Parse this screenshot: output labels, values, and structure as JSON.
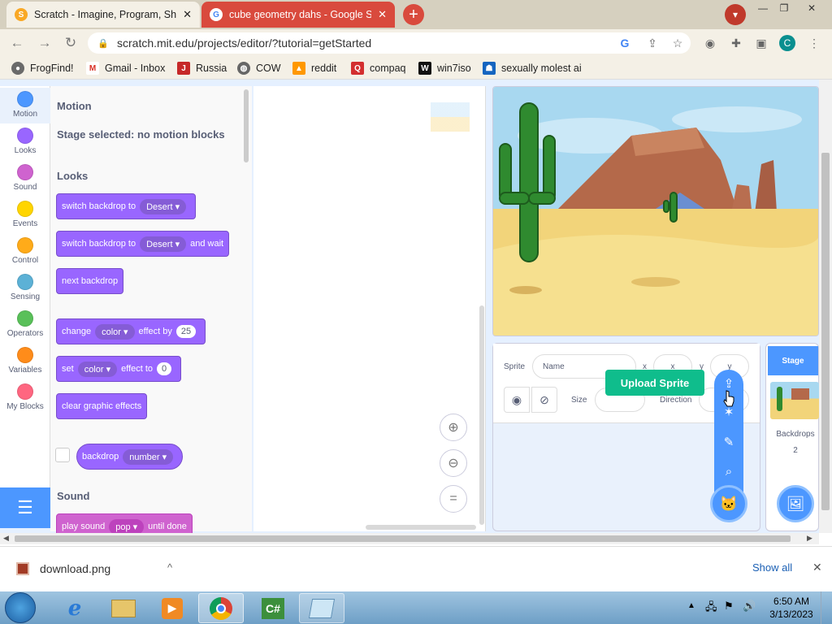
{
  "browser": {
    "tabs": [
      {
        "title": "Scratch - Imagine, Program, Share",
        "active": true
      },
      {
        "title": "cube geometry dahs - Google Search",
        "active": false
      }
    ],
    "url": "scratch.mit.edu/projects/editor/?tutorial=getStarted",
    "profile_initial": "C",
    "bookmarks": [
      {
        "label": "FrogFind!"
      },
      {
        "label": "Gmail - Inbox"
      },
      {
        "label": "Russia"
      },
      {
        "label": "COW"
      },
      {
        "label": "reddit"
      },
      {
        "label": "compaq"
      },
      {
        "label": "win7iso"
      },
      {
        "label": "sexually molest ai"
      }
    ]
  },
  "scratch": {
    "categories": [
      {
        "label": "Motion",
        "color": "#4c97ff"
      },
      {
        "label": "Looks",
        "color": "#9966ff"
      },
      {
        "label": "Sound",
        "color": "#cf63cf"
      },
      {
        "label": "Events",
        "color": "#ffd500"
      },
      {
        "label": "Control",
        "color": "#ffab19"
      },
      {
        "label": "Sensing",
        "color": "#5cb1d6"
      },
      {
        "label": "Operators",
        "color": "#59c059"
      },
      {
        "label": "Variables",
        "color": "#ff8c1a"
      },
      {
        "label": "My Blocks",
        "color": "#ff6680"
      }
    ],
    "palette": {
      "motion_heading": "Motion",
      "motion_note": "Stage selected: no motion blocks",
      "looks_heading": "Looks",
      "sound_heading": "Sound",
      "blocks": {
        "switch_backdrop": {
          "text": "switch backdrop to",
          "value": "Desert"
        },
        "switch_backdrop_wait": {
          "text": "switch backdrop to",
          "value": "Desert",
          "suffix": "and wait"
        },
        "next_backdrop": {
          "text": "next backdrop"
        },
        "change_effect": {
          "text": "change",
          "value": "color",
          "mid": "effect by",
          "num": "25"
        },
        "set_effect": {
          "text": "set",
          "value": "color",
          "mid": "effect to",
          "num": "0"
        },
        "clear_effects": {
          "text": "clear graphic effects"
        },
        "backdrop_reporter": {
          "text": "backdrop",
          "value": "number"
        },
        "play_sound": {
          "text": "play sound",
          "value": "pop",
          "suffix": "until done"
        }
      }
    },
    "sprite_info": {
      "sprite_label": "Sprite",
      "name_placeholder": "Name",
      "x_label": "x",
      "y_label": "y",
      "x_placeholder": "x",
      "y_placeholder": "y",
      "show_label": "Show",
      "size_label": "Size",
      "direction_label": "Direction"
    },
    "tooltip": "Upload Sprite",
    "stage_pane": {
      "title": "Stage",
      "backdrops_label": "Backdrops",
      "backdrops_count": "2"
    }
  },
  "downloads": {
    "file": "download.png",
    "show_all": "Show all"
  },
  "taskbar": {
    "time": "6:50 AM",
    "date": "3/13/2023"
  }
}
